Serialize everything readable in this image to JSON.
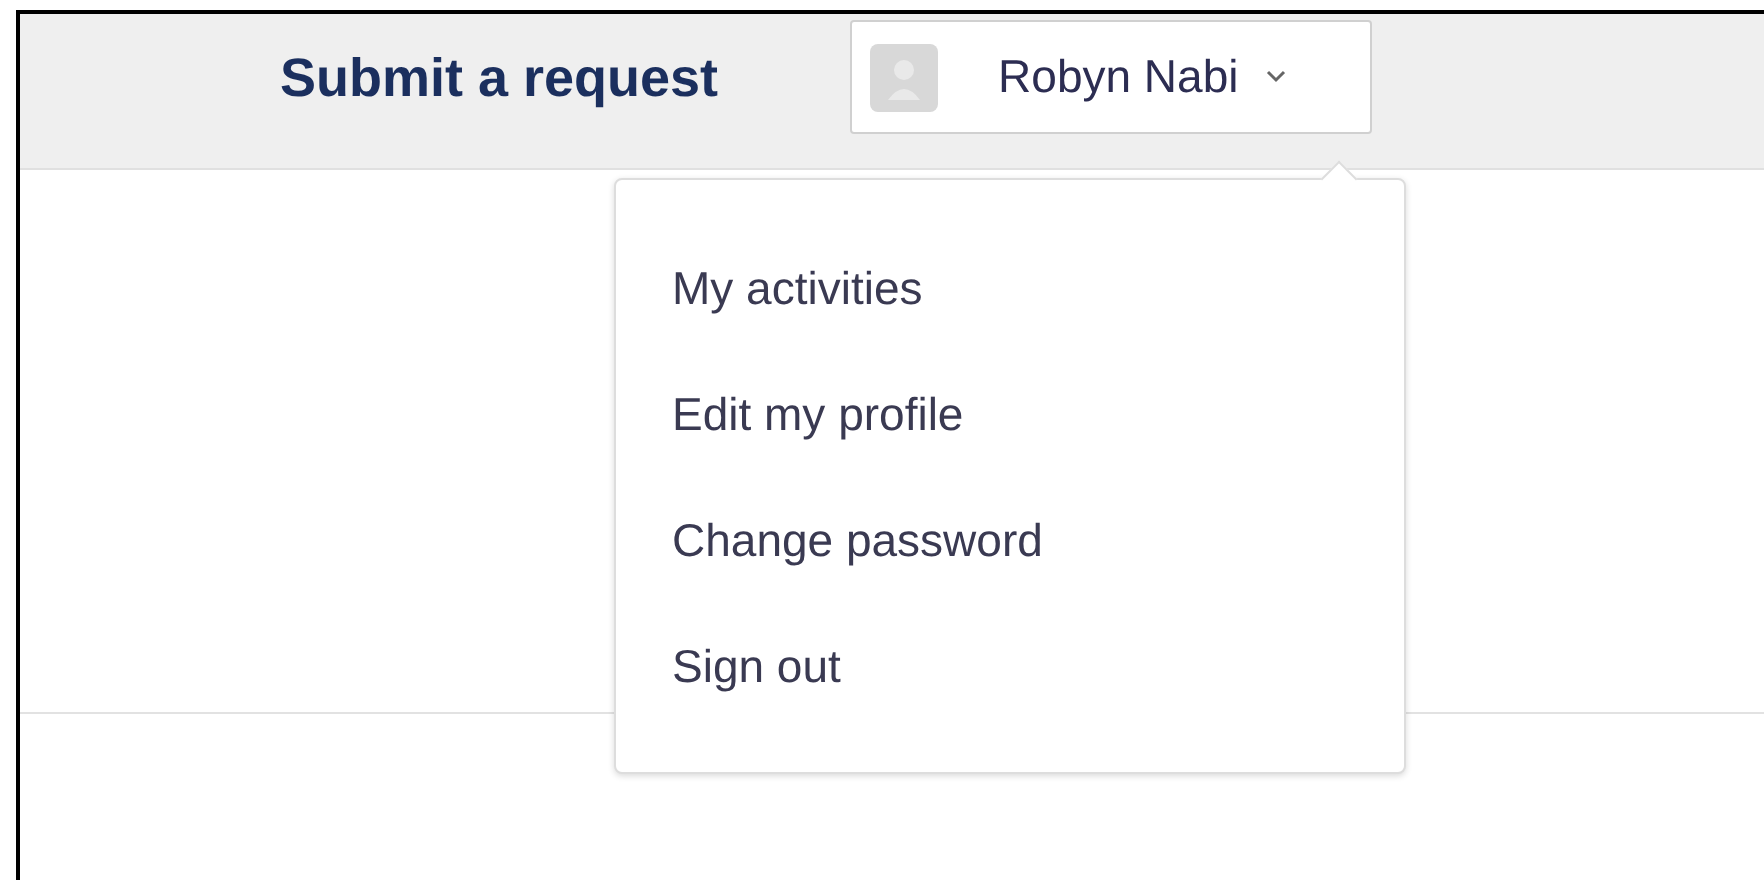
{
  "header": {
    "title": "Submit a request",
    "user_menu": {
      "name": "Robyn Nabi",
      "expanded": true
    }
  },
  "dropdown": {
    "items": [
      {
        "label": "My activities"
      },
      {
        "label": "Edit my profile"
      },
      {
        "label": "Change password"
      },
      {
        "label": "Sign out"
      }
    ]
  }
}
